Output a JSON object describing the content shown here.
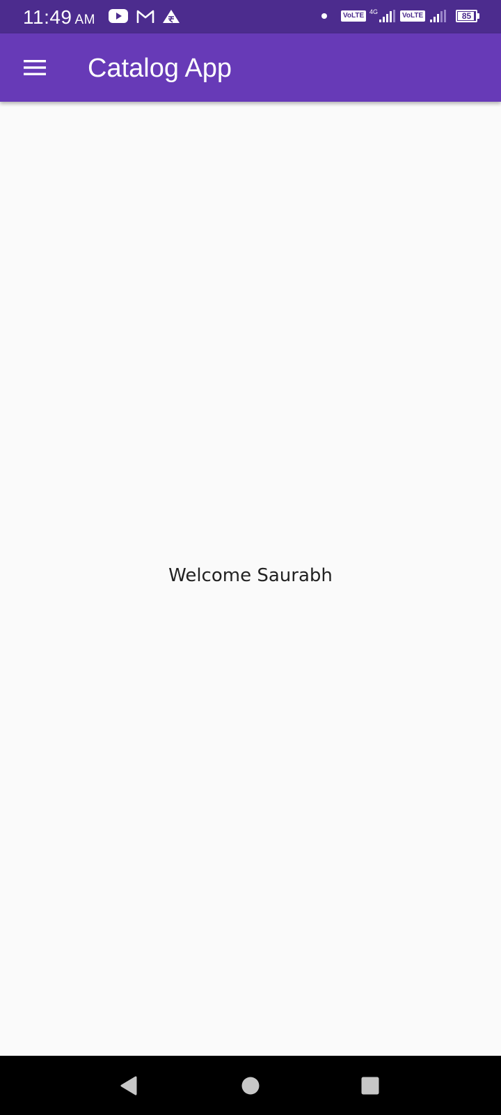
{
  "status_bar": {
    "time": "11:49",
    "ampm": "AM",
    "network_type": "4G",
    "volte_1": "VoLTE",
    "volte_2": "VoLTE",
    "battery_percent": "85",
    "icons": [
      "youtube-icon",
      "gmail-icon",
      "rupee-app-icon",
      "notification-dot-icon",
      "signal-icon",
      "signal-icon",
      "battery-icon"
    ]
  },
  "app_bar": {
    "title": "Catalog App",
    "menu_icon": "hamburger-menu-icon"
  },
  "main": {
    "welcome_text": "Welcome Saurabh"
  },
  "nav_bar": {
    "buttons": [
      "back-icon",
      "home-icon",
      "recents-icon"
    ]
  },
  "colors": {
    "status_bar": "#4c2c8e",
    "app_bar": "#673ab7",
    "background": "#fafafa",
    "nav_bar": "#000000"
  }
}
